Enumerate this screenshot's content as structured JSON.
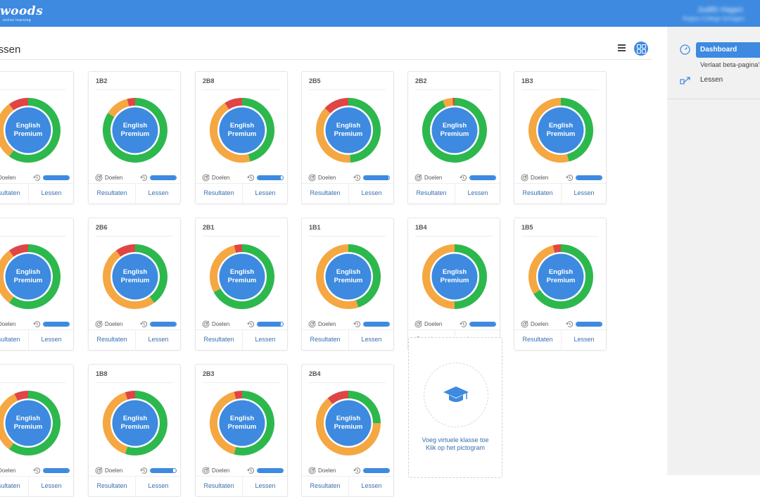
{
  "header": {
    "logo_text": "woods",
    "logo_sub": "online learning",
    "user_name": "Judith Hagen",
    "user_school": "Regius College Schagen"
  },
  "main": {
    "page_title": "Klassen"
  },
  "right_panel": {
    "items": [
      {
        "label": "Dashboard"
      },
      {
        "label": "Verlaat beta-pagina's"
      },
      {
        "label": "Lessen"
      }
    ]
  },
  "colors": {
    "accent": "#3d8ae0",
    "green": "#2db84d",
    "orange": "#f5a742",
    "red": "#e04545"
  },
  "icons": {
    "goal": "target-icon",
    "history": "history-icon",
    "list": "list-view-icon",
    "grid": "grid-view-icon",
    "add": "graduation-cap-icon"
  },
  "card_common": {
    "center_line1": "English",
    "center_line2": "Premium",
    "goals_label": "Doelen",
    "results_label": "Resultaten",
    "lessons_label": "Lessen"
  },
  "cards": [
    {
      "name": "",
      "green": 0.6,
      "orange": 0.3,
      "red": 0.1,
      "progress": 1.0
    },
    {
      "name": "1B2",
      "green": 0.84,
      "orange": 0.12,
      "red": 0.04,
      "progress": 1.0
    },
    {
      "name": "2B8",
      "green": 0.46,
      "orange": 0.45,
      "red": 0.09,
      "progress": 0.92
    },
    {
      "name": "2B5",
      "green": 0.49,
      "orange": 0.38,
      "red": 0.13,
      "progress": 0.96
    },
    {
      "name": "2B2",
      "green": 0.94,
      "orange": 0.05,
      "red": 0.01,
      "progress": 1.0
    },
    {
      "name": "1B3",
      "green": 0.46,
      "orange": 0.54,
      "red": 0.0,
      "progress": 1.0
    },
    {
      "name": "",
      "green": 0.6,
      "orange": 0.3,
      "red": 0.1,
      "progress": 1.0
    },
    {
      "name": "2B6",
      "green": 0.4,
      "orange": 0.5,
      "red": 0.1,
      "progress": 1.0
    },
    {
      "name": "2B1",
      "green": 0.67,
      "orange": 0.29,
      "red": 0.04,
      "progress": 0.92
    },
    {
      "name": "1B1",
      "green": 0.45,
      "orange": 0.55,
      "red": 0.0,
      "progress": 1.0
    },
    {
      "name": "1B4",
      "green": 0.5,
      "orange": 0.5,
      "red": 0.0,
      "progress": 1.0
    },
    {
      "name": "1B5",
      "green": 0.66,
      "orange": 0.3,
      "red": 0.04,
      "progress": 1.0
    },
    {
      "name": "",
      "green": 0.6,
      "orange": 0.33,
      "red": 0.07,
      "progress": 1.0
    },
    {
      "name": "1B8",
      "green": 0.55,
      "orange": 0.4,
      "red": 0.05,
      "progress": 0.88
    },
    {
      "name": "2B3",
      "green": 0.54,
      "orange": 0.42,
      "red": 0.04,
      "progress": 1.0
    },
    {
      "name": "2B4",
      "green": 0.25,
      "orange": 0.64,
      "red": 0.11,
      "progress": 1.0
    }
  ],
  "add_card": {
    "line1": "Voeg virtuele klasse toe",
    "line2": "Klik op het pictogram"
  }
}
